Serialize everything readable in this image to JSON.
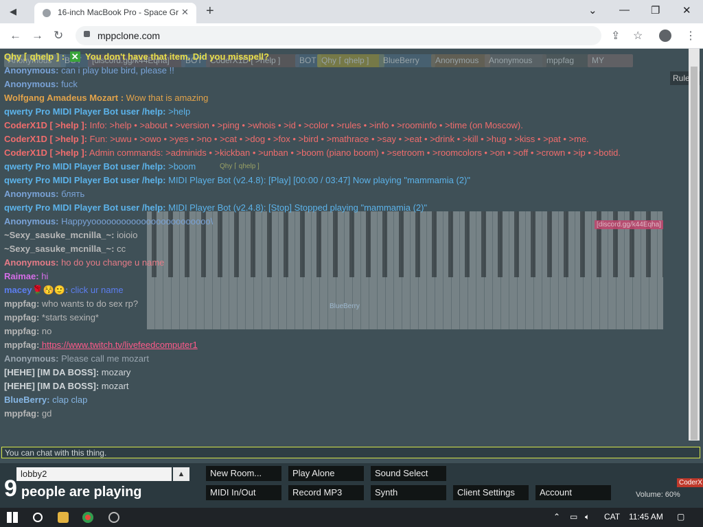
{
  "browser": {
    "tab_title": "16-inch MacBook Pro - Space Gr",
    "url": "mppclone.com",
    "tab_back_icon": "tab-search-icon",
    "new_tab_icon": "plus-icon"
  },
  "status": {
    "top_notice": "Qhy ⌈ qhelp ] :",
    "notice_icon": "✕",
    "notice_text": "You don't have that item. Did you misspell?"
  },
  "users": [
    {
      "name": "Anonymous",
      "color": "#7c8b8e"
    },
    {
      "name": "BOT",
      "color": "#4d6d86"
    },
    {
      "name": "[discord.gg/k44Eqha]",
      "color": "#6b5c63"
    },
    {
      "name": "BOT",
      "color": "#4d6d86"
    },
    {
      "name": "CoderX1D [ >help ]",
      "color": "#6a5b5b"
    },
    {
      "name": "BOT",
      "color": "#4d6d86"
    },
    {
      "name": "Qhy ⌈ qhelp ]",
      "color": "#a39b3a"
    },
    {
      "name": "BlueBerry",
      "color": "#4f6e86"
    },
    {
      "name": "Anonymous",
      "color": "#7d6d52"
    },
    {
      "name": "Anonymous",
      "color": "#6d6f72"
    },
    {
      "name": "mppfag",
      "color": "#585d5d"
    },
    {
      "name": "MY",
      "color": "#7b6e70"
    }
  ],
  "chat": [
    {
      "who": "Anonymous:",
      "msg": "can i play blue bird, please !!",
      "c": "#7aa3d8"
    },
    {
      "who": "Anonymous:",
      "msg": "fuck",
      "c": "#7aa3d8"
    },
    {
      "who": "Wolfgang Amadeus Mozart :",
      "msg": "Wow that is amazing",
      "c": "#e2a34a"
    },
    {
      "who": "qwerty Pro MIDI Player Bot user /help:",
      "msg": ">help",
      "c": "#5cb3ea"
    },
    {
      "who": "CoderX1D [ >help ]:",
      "msg": "Info: >help • >about • >version • >ping • >whois • >id • >color • >rules • >info • >roominfo • >time (on Moscow).",
      "c": "#f06d6d"
    },
    {
      "who": "CoderX1D [ >help ]:",
      "msg": "Fun: >uwu • >owo • >yes • >no • >cat • >dog • >fox • >bird • >mathrace • >say • >eat • >drink • >kill • >hug • >kiss • >pat • >me.",
      "c": "#f06d6d",
      "wrap": true
    },
    {
      "who": "CoderX1D [ >help ]:",
      "msg": "Admin commands: >adminids • >kickban • >unban • >boom (piano boom) • >setroom • >roomcolors • >on • >off • >crown • >ip • >botid.",
      "c": "#f06d6d",
      "wrap": true
    },
    {
      "who": "qwerty Pro MIDI Player Bot user /help:",
      "msg": ">boom",
      "c": "#5cb3ea"
    },
    {
      "who": "qwerty Pro MIDI Player Bot user /help:",
      "msg": "MIDI Player Bot (v2.4.8): [Play] [00:00 / 03:47] Now playing \"mammamia (2)\"",
      "c": "#5cb3ea"
    },
    {
      "who": "Anonymous:",
      "msg": "блять",
      "c": "#7aa3d8"
    },
    {
      "who": "qwerty Pro MIDI Player Bot user /help:",
      "msg": "MIDI Player Bot (v2.4.8): [Stop] Stopped playing \"mammamia (2)\"",
      "c": "#5cb3ea"
    },
    {
      "who": "Anonymous:",
      "msg": "Happyyoooooooooooooooooooooooo\\",
      "c": "#7aa3d8"
    },
    {
      "who": "~Sexy_sasuke_mcnilla_~:",
      "msg": "ioioio",
      "c": "#b9b9b9"
    },
    {
      "who": "~Sexy_sasuke_mcnilla_~:",
      "msg": "cc",
      "c": "#b9b9b9"
    },
    {
      "who": "Anonymous:",
      "msg": "ho do you change u name",
      "c": "#e57b87"
    },
    {
      "who": "Raimae:",
      "msg": "hi",
      "c": "#d66ee8"
    },
    {
      "who": "macey🌹😚🙂:",
      "msg": "click ur name",
      "c": "#5c7ef0"
    },
    {
      "who": "mppfag:",
      "msg": "who wants to do sex rp?",
      "c": "#b7b7b7"
    },
    {
      "who": "mppfag:",
      "msg": "*starts sexing*",
      "c": "#b7b7b7"
    },
    {
      "who": "mppfag:",
      "msg": "no",
      "c": "#b7b7b7"
    },
    {
      "who": "mppfag:",
      "msg": "https://www.twitch.tv/livefeedcomputer1",
      "c": "#b7b7b7",
      "link": true
    },
    {
      "who": "Anonymous:",
      "msg": "Please call me mozart",
      "c": "#9aa6b0"
    },
    {
      "who": "[HEHE] [IM DA BOSS]:",
      "msg": "mozary",
      "c": "#d2d7da"
    },
    {
      "who": "[HEHE] [IM DA BOSS]:",
      "msg": "mozart",
      "c": "#d2d7da"
    },
    {
      "who": "BlueBerry:",
      "msg": "clap clap",
      "c": "#86b6e4"
    },
    {
      "who": "mppfag:",
      "msg": "gd",
      "c": "#b7b7b7"
    }
  ],
  "chat_placeholder": "You can chat with this thing.",
  "side": {
    "rule_label": "Rule"
  },
  "room": {
    "name": "lobby2",
    "toggle_icon": "▲"
  },
  "players": {
    "count": "9",
    "text": "people are playing"
  },
  "buttons": {
    "new_room": "New Room...",
    "play_alone": "Play Alone",
    "sound_select": "Sound Select",
    "midi_inout": "MIDI In/Out",
    "record_mp3": "Record MP3",
    "synth": "Synth",
    "client_settings": "Client Settings",
    "account": "Account"
  },
  "volume": "Volume: 60%",
  "cursor_tags": {
    "qhy": "Qhy ⌈ qhelp ]",
    "discord": "[discord.gg/k44Eqha]",
    "blueberry": "BlueBerry",
    "coder": "CoderX"
  },
  "taskbar": {
    "lang": "CAT",
    "time": "11:45 AM"
  }
}
